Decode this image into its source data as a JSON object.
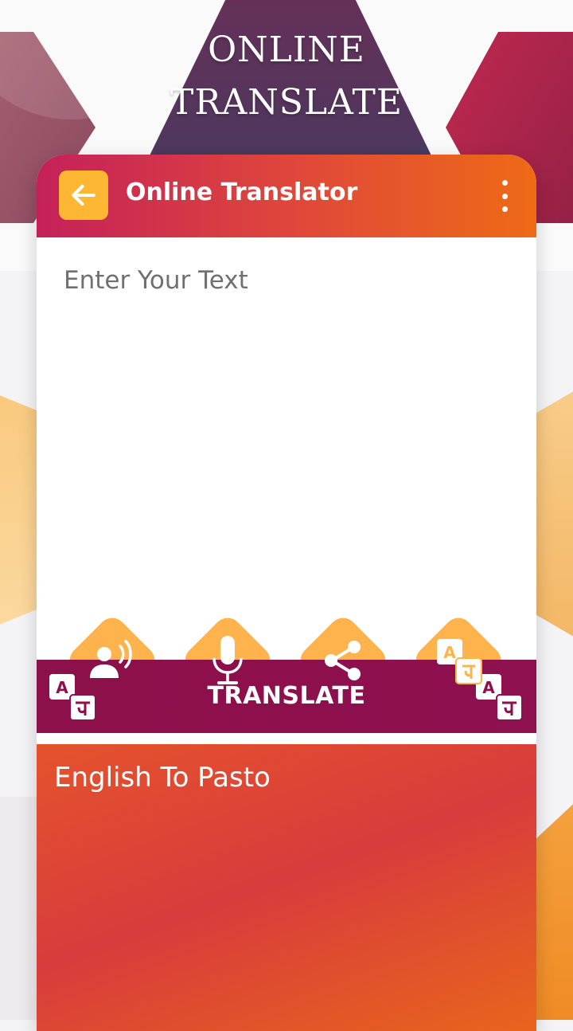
{
  "headline": {
    "line1": "ONLINE",
    "line2": "TRANSLATE"
  },
  "appbar": {
    "title": "Online Translator",
    "back_icon": "arrow-left-icon",
    "menu_icon": "more-vertical-icon"
  },
  "input": {
    "placeholder": "Enter Your Text",
    "value": ""
  },
  "actions": [
    {
      "name": "speak",
      "icon": "speaker-person-icon"
    },
    {
      "name": "microphone",
      "icon": "microphone-icon"
    },
    {
      "name": "share",
      "icon": "share-icon"
    },
    {
      "name": "translate",
      "icon": "translate-icon"
    }
  ],
  "translate_bar": {
    "label": "TRANSLATE"
  },
  "output": {
    "text": "English To Pasto"
  },
  "colors": {
    "accent_orange": "#feb34d",
    "back_button": "#fdb732",
    "bar_purple": "#8c1049",
    "appbar_start": "#c4215a",
    "appbar_end": "#ee6a17"
  }
}
